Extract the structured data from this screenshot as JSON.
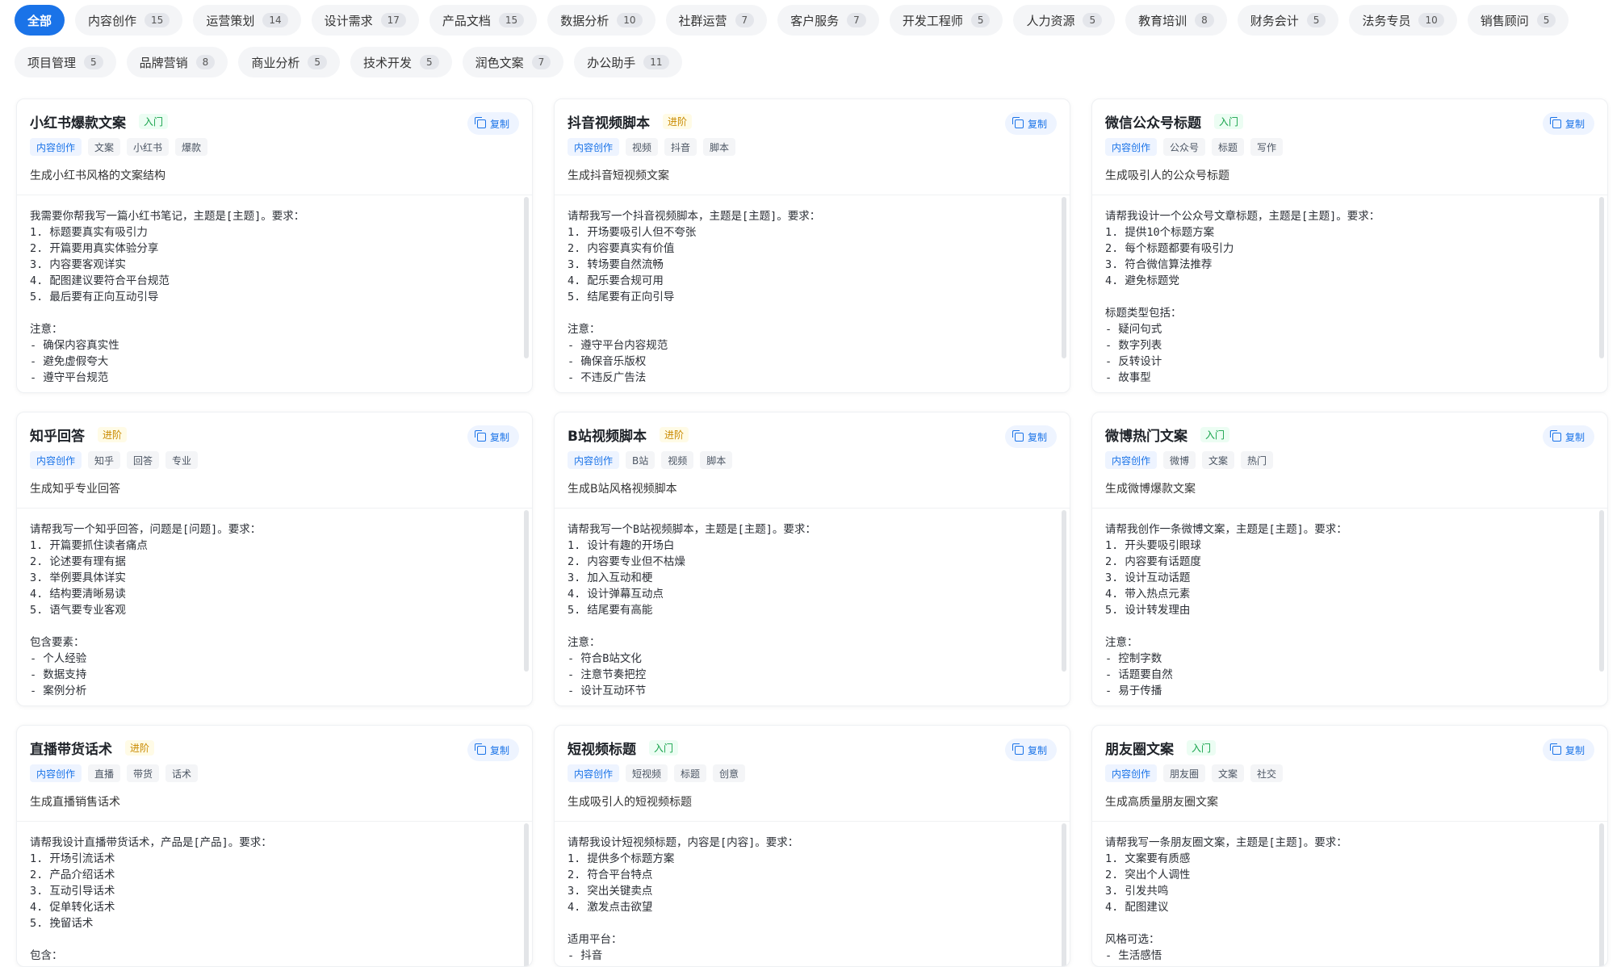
{
  "categories": [
    {
      "label": "全部",
      "count": null,
      "active": true
    },
    {
      "label": "内容创作",
      "count": "15"
    },
    {
      "label": "运营策划",
      "count": "14"
    },
    {
      "label": "设计需求",
      "count": "17"
    },
    {
      "label": "产品文档",
      "count": "15"
    },
    {
      "label": "数据分析",
      "count": "10"
    },
    {
      "label": "社群运营",
      "count": "7"
    },
    {
      "label": "客户服务",
      "count": "7"
    },
    {
      "label": "开发工程师",
      "count": "5"
    },
    {
      "label": "人力资源",
      "count": "5"
    },
    {
      "label": "教育培训",
      "count": "8"
    },
    {
      "label": "财务会计",
      "count": "5"
    },
    {
      "label": "法务专员",
      "count": "10"
    },
    {
      "label": "销售顾问",
      "count": "5"
    },
    {
      "label": "项目管理",
      "count": "5"
    },
    {
      "label": "品牌营销",
      "count": "8"
    },
    {
      "label": "商业分析",
      "count": "5"
    },
    {
      "label": "技术开发",
      "count": "5"
    },
    {
      "label": "润色文案",
      "count": "7"
    },
    {
      "label": "办公助手",
      "count": "11"
    }
  ],
  "copy_label": "复制",
  "cards": [
    {
      "title": "小红书爆款文案",
      "level": "入门",
      "level_color": "#16a34a",
      "tags": [
        "内容创作",
        "文案",
        "小红书",
        "爆款"
      ],
      "desc": "生成小红书风格的文案结构",
      "prompt": "我需要你帮我写一篇小红书笔记，主题是[主题]。要求：\n1. 标题要真实有吸引力\n2. 开篇要用真实体验分享\n3. 内容要客观详实\n4. 配图建议要符合平台规范\n5. 最后要有正向互动引导\n\n注意：\n- 确保内容真实性\n- 避免虚假夸大\n- 遵守平台规范"
    },
    {
      "title": "抖音视频脚本",
      "level": "进阶",
      "level_color": "#c98a00",
      "tags": [
        "内容创作",
        "视频",
        "抖音",
        "脚本"
      ],
      "desc": "生成抖音短视频文案",
      "prompt": "请帮我写一个抖音视频脚本，主题是[主题]。要求：\n1. 开场要吸引人但不夸张\n2. 内容要真实有价值\n3. 转场要自然流畅\n4. 配乐要合规可用\n5. 结尾要有正向引导\n\n注意：\n- 遵守平台内容规范\n- 确保音乐版权\n- 不违反广告法"
    },
    {
      "title": "微信公众号标题",
      "level": "入门",
      "level_color": "#16a34a",
      "tags": [
        "内容创作",
        "公众号",
        "标题",
        "写作"
      ],
      "desc": "生成吸引人的公众号标题",
      "prompt": "请帮我设计一个公众号文章标题，主题是[主题]。要求：\n1. 提供10个标题方案\n2. 每个标题都要有吸引力\n3. 符合微信算法推荐\n4. 避免标题党\n\n标题类型包括：\n- 疑问句式\n- 数字列表\n- 反转设计\n- 故事型"
    },
    {
      "title": "知乎回答",
      "level": "进阶",
      "level_color": "#c98a00",
      "tags": [
        "内容创作",
        "知乎",
        "回答",
        "专业"
      ],
      "desc": "生成知乎专业回答",
      "prompt": "请帮我写一个知乎回答，问题是[问题]。要求：\n1. 开篇要抓住读者痛点\n2. 论述要有理有据\n3. 举例要具体详实\n4. 结构要清晰易读\n5. 语气要专业客观\n\n包含要素：\n- 个人经验\n- 数据支持\n- 案例分析"
    },
    {
      "title": "B站视频脚本",
      "level": "进阶",
      "level_color": "#c98a00",
      "tags": [
        "内容创作",
        "B站",
        "视频",
        "脚本"
      ],
      "desc": "生成B站风格视频脚本",
      "prompt": "请帮我写一个B站视频脚本，主题是[主题]。要求：\n1. 设计有趣的开场白\n2. 内容要专业但不枯燥\n3. 加入互动和梗\n4. 设计弹幕互动点\n5. 结尾要有高能\n\n注意：\n- 符合B站文化\n- 注意节奏把控\n- 设计互动环节"
    },
    {
      "title": "微博热门文案",
      "level": "入门",
      "level_color": "#16a34a",
      "tags": [
        "内容创作",
        "微博",
        "文案",
        "热门"
      ],
      "desc": "生成微博爆款文案",
      "prompt": "请帮我创作一条微博文案，主题是[主题]。要求：\n1. 开头要吸引眼球\n2. 内容要有话题度\n3. 设计互动话题\n4. 带入热点元素\n5. 设计转发理由\n\n注意：\n- 控制字数\n- 话题要自然\n- 易于传播"
    },
    {
      "title": "直播带货话术",
      "level": "进阶",
      "level_color": "#c98a00",
      "tags": [
        "内容创作",
        "直播",
        "带货",
        "话术"
      ],
      "desc": "生成直播销售话术",
      "prompt": "请帮我设计直播带货话术，产品是[产品]。要求：\n1. 开场引流话术\n2. 产品介绍话术\n3. 互动引导话术\n4. 促单转化话术\n5. 挽留话术\n\n包含："
    },
    {
      "title": "短视频标题",
      "level": "入门",
      "level_color": "#16a34a",
      "tags": [
        "内容创作",
        "短视频",
        "标题",
        "创意"
      ],
      "desc": "生成吸引人的短视频标题",
      "prompt": "请帮我设计短视频标题，内容是[内容]。要求：\n1. 提供多个标题方案\n2. 符合平台特点\n3. 突出关键卖点\n4. 激发点击欲望\n\n适用平台：\n- 抖音"
    },
    {
      "title": "朋友圈文案",
      "level": "入门",
      "level_color": "#16a34a",
      "tags": [
        "内容创作",
        "朋友圈",
        "文案",
        "社交"
      ],
      "desc": "生成高质量朋友圈文案",
      "prompt": "请帮我写一条朋友圈文案，主题是[主题]。要求：\n1. 文案要有质感\n2. 突出个人调性\n3. 引发共鸣\n4. 配图建议\n\n风格可选：\n- 生活感悟"
    }
  ]
}
